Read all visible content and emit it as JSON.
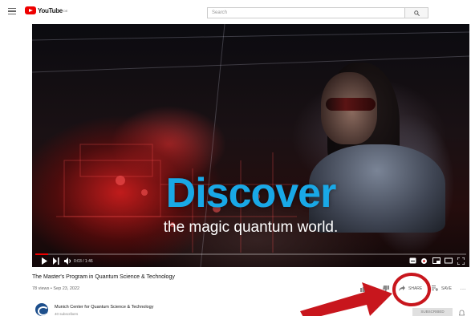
{
  "header": {
    "logo_text": "YouTube",
    "logo_sup": "DE",
    "search_placeholder": "Search"
  },
  "video": {
    "overlay_title": "Discover",
    "overlay_subtitle": "the magic quantum world.",
    "time": "0:03 / 1:46",
    "progress_fraction": 0.03,
    "title": "The Master's Program in Quantum Science & Technology",
    "meta": "78 views • Sep 23, 2022"
  },
  "actions": {
    "share_label": "SHARE",
    "save_label": "SAVE"
  },
  "channel": {
    "name": "Munich Center for Quantum Science & Technology",
    "subscribers": "40 subscribers",
    "subscribe_label": "SUBSCRIBED"
  },
  "colors": {
    "brand_red": "#ee0000",
    "discover_blue": "#19a8e6",
    "annotation_red": "#c8161d"
  }
}
